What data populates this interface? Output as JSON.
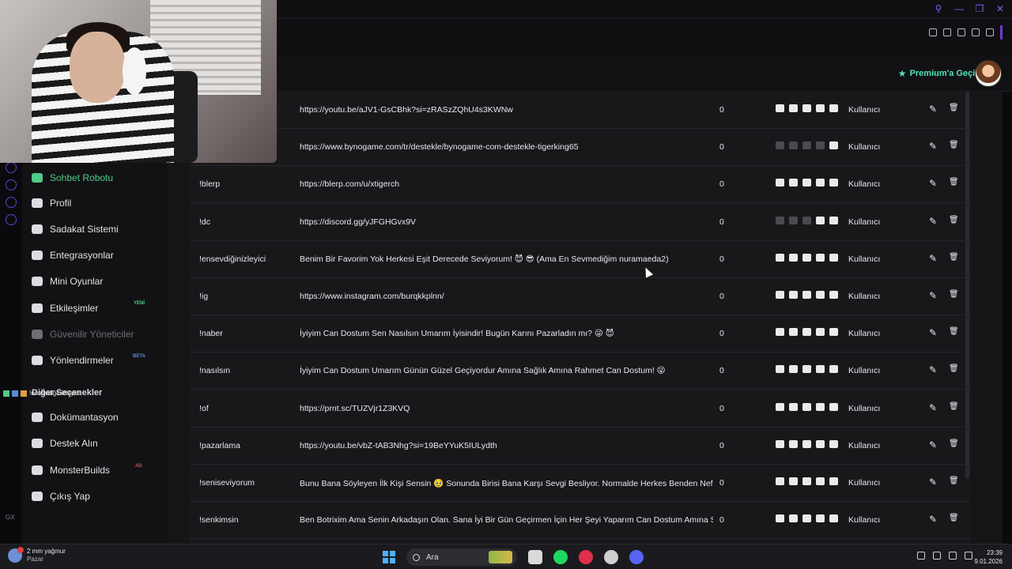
{
  "header": {
    "premium_label": "Premium'a Geçin"
  },
  "sidebar": {
    "items": [
      {
        "label": "Sohbet Robotu",
        "icon": "robot-icon"
      },
      {
        "label": "Profil",
        "icon": "id-card-icon"
      },
      {
        "label": "Sadakat Sistemi",
        "icon": "trophy-icon"
      },
      {
        "label": "Entegrasyonlar",
        "icon": "plug-icon"
      },
      {
        "label": "Mini Oyunlar",
        "icon": "gamepad-icon"
      },
      {
        "label": "Etkileşimler",
        "icon": "music-note-icon",
        "badge": "YENİ"
      },
      {
        "label": "Güvenilir Yöneticiler",
        "icon": "users-icon"
      },
      {
        "label": "Yönlendirmeler",
        "icon": "users-icon",
        "badge": "BETA"
      },
      {
        "label": "Dokümantasyon",
        "icon": "book-icon"
      },
      {
        "label": "Destek Alın",
        "icon": "question-icon"
      },
      {
        "label": "MonsterBuilds",
        "icon": "laptop-icon",
        "badge": "AD"
      },
      {
        "label": "Çıkış Yap",
        "icon": "sign-out-icon"
      }
    ],
    "section_title": "Diğer Seçenekler"
  },
  "overlay": {
    "chat_text": "!ensevdiğinizleyici"
  },
  "table": {
    "rows": [
      {
        "command": "",
        "response": "https://youtu.be/aJV1-GsCBhk?si=zRASzZQhU4s3KWNw",
        "uses": "0",
        "permission": "Kullanıcı",
        "platforms": [
          true,
          true,
          true,
          true,
          true
        ]
      },
      {
        "command": "",
        "response": "https://www.bynogame.com/tr/destekle/bynogame-com-destekle-tigerking65",
        "uses": "0",
        "permission": "Kullanıcı",
        "platforms": [
          false,
          false,
          false,
          false,
          true
        ]
      },
      {
        "command": "!blerp",
        "response": "https://blerp.com/u/xtigerch",
        "uses": "0",
        "permission": "Kullanıcı",
        "platforms": [
          true,
          true,
          true,
          true,
          true
        ]
      },
      {
        "command": "!dc",
        "response": "https://discord.gg/yJFGHGvx9V",
        "uses": "0",
        "permission": "Kullanıcı",
        "platforms": [
          false,
          false,
          false,
          true,
          true
        ]
      },
      {
        "command": "!ensevdiğinizleyici",
        "response": "Benim Bir Favorim Yok Herkesi Eşit Derecede Seviyorum! 😈 😎 (Ama En Sevmediğim nuramaeda2)",
        "uses": "0",
        "permission": "Kullanıcı",
        "platforms": [
          true,
          true,
          true,
          true,
          true
        ]
      },
      {
        "command": "!ig",
        "response": "https://www.instagram.com/burqkkplnn/",
        "uses": "0",
        "permission": "Kullanıcı",
        "platforms": [
          true,
          true,
          true,
          true,
          true
        ]
      },
      {
        "command": "!naber",
        "response": "İyiyim Can Dostum Sen Nasılsın Umarım İyisindir! Bugün Karını Pazarladın mı? 😜 😈",
        "uses": "0",
        "permission": "Kullanıcı",
        "platforms": [
          true,
          true,
          true,
          true,
          true
        ]
      },
      {
        "command": "!nasılsın",
        "response": "İyiyim Can Dostum Umarım Günün Güzel Geçiyordur Amına Sağlık Amına Rahmet Can Dostum! 😜",
        "uses": "0",
        "permission": "Kullanıcı",
        "platforms": [
          true,
          true,
          true,
          true,
          true
        ]
      },
      {
        "command": "!of",
        "response": "https://prnt.sc/TUZVjr1Z3KVQ",
        "uses": "0",
        "permission": "Kullanıcı",
        "platforms": [
          true,
          true,
          true,
          true,
          true
        ]
      },
      {
        "command": "!pazarlama",
        "response": "https://youtu.be/vbZ-tAB3Nhg?si=19BeYYuK5IULydth",
        "uses": "0",
        "permission": "Kullanıcı",
        "platforms": [
          true,
          true,
          true,
          true,
          true
        ]
      },
      {
        "command": "!seniseviyorum",
        "response": "Bunu Bana Söyleyen İlk Kişi Sensin 🥹 Sonunda Birisi Bana Karşı Sevgi Besliyor. Normalde Herkes Benden Nefret",
        "uses": "0",
        "permission": "Kullanıcı",
        "platforms": [
          true,
          true,
          true,
          true,
          true
        ]
      },
      {
        "command": "!senkimsin",
        "response": "Ben Botrixim Ama Senin Arkadaşın Olan. Sana İyi Bir Gün Geçirmen İçin Her Şeyi Yaparım Can Dostum Amına Sa",
        "uses": "0",
        "permission": "Kullanıcı",
        "platforms": [
          true,
          true,
          true,
          true,
          true
        ]
      }
    ]
  },
  "taskbar": {
    "weather_temp": "2 mm yağmur",
    "weather_day": "Pazar",
    "search_placeholder": "Ara",
    "time": "23:39",
    "date": "9.01.2026"
  },
  "gx_label": "GX",
  "colors": {
    "accent": "#53c98a",
    "premium": "#53e3b9",
    "gx_purple": "#6b3bd1"
  }
}
